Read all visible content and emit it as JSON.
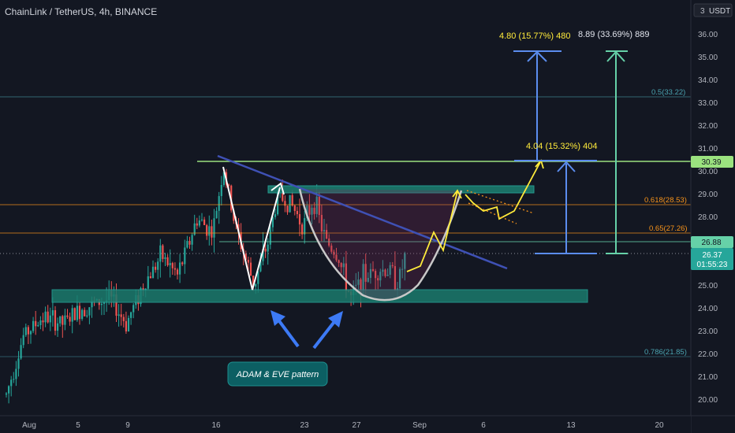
{
  "header": {
    "title": "ChainLink / TetherUS, 4h, BINANCE",
    "scale_badge": "3",
    "currency": "USDT"
  },
  "colors": {
    "background": "#131722",
    "bull": "#26a69a",
    "bear": "#ef5350",
    "fib": "#f7931a",
    "green_line": "#9be27f",
    "blue_line": "#3f51b5",
    "pattern_box": "#1b7a6d",
    "projection": "#ffeb3b",
    "measure_blue": "#5b8def",
    "measure_green": "#66d1a8"
  },
  "chart_data": {
    "type": "candlestick",
    "symbol": "ChainLink / TetherUS",
    "interval": "4h",
    "exchange": "BINANCE",
    "x_ticks": [
      "Aug",
      "5",
      "9",
      "16",
      "23",
      "27",
      "Sep",
      "6",
      "13",
      "20"
    ],
    "y_ticks": [
      "20.00",
      "21.00",
      "22.00",
      "23.00",
      "24.00",
      "25.00",
      "26.00",
      "27.00",
      "28.00",
      "29.00",
      "30.00",
      "31.00",
      "32.00",
      "33.00",
      "34.00",
      "35.00",
      "36.00"
    ],
    "ylim": [
      19.5,
      36.5
    ],
    "fib_levels": [
      {
        "label": "0.5(33.22)",
        "value": 33.22
      },
      {
        "label": "0.618(28.53)",
        "value": 28.53
      },
      {
        "label": "0.65(27.26)",
        "value": 27.26
      },
      {
        "label": "0.786(21.85)",
        "value": 21.85
      }
    ],
    "price_labels": [
      {
        "text": "30.39",
        "value": 30.39,
        "kind": "resistance"
      },
      {
        "text": "26.88",
        "value": 26.88,
        "kind": "level"
      },
      {
        "text": "26.37",
        "value": 26.37,
        "kind": "current",
        "countdown": "01:55:23"
      }
    ],
    "targets": [
      {
        "label": "4.04 (15.32%) 404",
        "from": 26.35,
        "to": 30.39
      },
      {
        "label": "4.80 (15.77%) 480",
        "from": 30.39,
        "to": 35.19
      },
      {
        "label": "8.89 (33.69%) 889",
        "from": 26.35,
        "to": 35.24
      }
    ],
    "zones": [
      {
        "name": "support",
        "low": 24.35,
        "high": 24.85
      },
      {
        "name": "neckline",
        "low": 29.05,
        "high": 29.35
      }
    ],
    "annotation": "ADAM & EVE pattern"
  }
}
